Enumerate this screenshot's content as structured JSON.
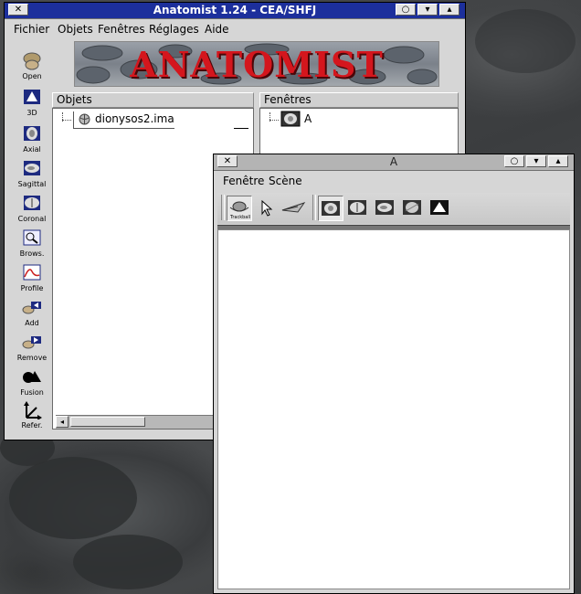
{
  "main_window": {
    "title": "Anatomist 1.24 - CEA/SHFJ",
    "menu": [
      "Fichier",
      "Objets",
      "Fenêtres",
      "Réglages",
      "Aide"
    ],
    "banner_text": "ANATOMIST",
    "tools": [
      {
        "label": "Open",
        "icon": "open-brain-icon"
      },
      {
        "label": "3D",
        "icon": "3d-view-icon"
      },
      {
        "label": "Axial",
        "icon": "axial-view-icon"
      },
      {
        "label": "Sagittal",
        "icon": "sagittal-view-icon"
      },
      {
        "label": "Coronal",
        "icon": "coronal-view-icon"
      },
      {
        "label": "Brows.",
        "icon": "browser-icon"
      },
      {
        "label": "Profile",
        "icon": "profile-icon"
      },
      {
        "label": "Add",
        "icon": "add-icon"
      },
      {
        "label": "Remove",
        "icon": "remove-icon"
      },
      {
        "label": "Fusion",
        "icon": "fusion-icon"
      },
      {
        "label": "Refer.",
        "icon": "referential-icon"
      }
    ],
    "objects_header": "Objets",
    "windows_header": "Fenêtres",
    "objects": [
      {
        "name": "dionysos2.ima",
        "icon": "volume-icon"
      }
    ],
    "windows": [
      {
        "name": "A",
        "icon": "axial-window-icon"
      }
    ]
  },
  "view_window": {
    "title": "A",
    "menu": [
      "Fenêtre",
      "Scène"
    ],
    "controls": [
      {
        "label": "Trackball",
        "icon": "trackball-icon"
      },
      {
        "label": "",
        "icon": "select-arrow-icon"
      },
      {
        "label": "",
        "icon": "flight-icon"
      }
    ],
    "views": [
      "axial-view-icon",
      "coronal-view-icon",
      "sagittal-view-icon",
      "oblique-view-icon",
      "3d-view-icon"
    ]
  }
}
